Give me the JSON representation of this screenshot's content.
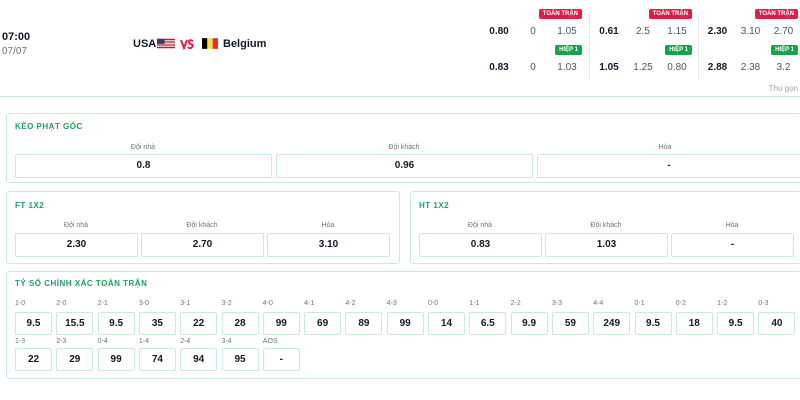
{
  "match": {
    "time": "07:00",
    "date": "07/07",
    "home_team": "USA",
    "away_team": "Belgium"
  },
  "odds": [
    {
      "badge_full": "TOÀN TRẬN",
      "full": [
        "0.80",
        "0",
        "1.05"
      ],
      "badge_half": "HIỆP 1",
      "half": [
        "0.83",
        "0",
        "1.03"
      ]
    },
    {
      "badge_full": "TOÀN TRẬN",
      "full": [
        "0.61",
        "2.5",
        "1.15"
      ],
      "badge_half": "HIỆP 1",
      "half": [
        "1.05",
        "1.25",
        "0.80"
      ]
    },
    {
      "badge_full": "TOÀN TRẬN",
      "full": [
        "2.30",
        "3.10",
        "2.70"
      ],
      "badge_half": "HIỆP 1",
      "half": [
        "2.88",
        "2.38",
        "3.2"
      ]
    }
  ],
  "collapse_label": "Thu gọn",
  "corner": {
    "title": "KÈO PHẠT GÓC",
    "cols": [
      {
        "label": "Đội nhà",
        "value": "0.8"
      },
      {
        "label": "Đội khách",
        "value": "0.96"
      },
      {
        "label": "Hòa",
        "value": "-"
      }
    ]
  },
  "ft": {
    "title": "FT 1X2",
    "cols": [
      {
        "label": "Đội nhà",
        "value": "2.30"
      },
      {
        "label": "Đội khách",
        "value": "2.70"
      },
      {
        "label": "Hòa",
        "value": "3.10"
      }
    ]
  },
  "ht": {
    "title": "HT 1X2",
    "cols": [
      {
        "label": "Đội nhà",
        "value": "0.83"
      },
      {
        "label": "Đội khách",
        "value": "1.03"
      },
      {
        "label": "Hòa",
        "value": "-"
      }
    ]
  },
  "exact": {
    "title": "TỶ SỐ CHÍNH XÁC TOÀN TRẬN",
    "row1": [
      {
        "score": "1-0",
        "odd": "9.5"
      },
      {
        "score": "2-0",
        "odd": "15.5"
      },
      {
        "score": "2-1",
        "odd": "9.5"
      },
      {
        "score": "3-0",
        "odd": "35"
      },
      {
        "score": "3-1",
        "odd": "22"
      },
      {
        "score": "3-2",
        "odd": "28"
      },
      {
        "score": "4-0",
        "odd": "99"
      },
      {
        "score": "4-1",
        "odd": "69"
      },
      {
        "score": "4-2",
        "odd": "89"
      },
      {
        "score": "4-3",
        "odd": "99"
      },
      {
        "score": "0-0",
        "odd": "14"
      },
      {
        "score": "1-1",
        "odd": "6.5"
      },
      {
        "score": "2-2",
        "odd": "9.9"
      },
      {
        "score": "3-3",
        "odd": "59"
      },
      {
        "score": "4-4",
        "odd": "249"
      },
      {
        "score": "0-1",
        "odd": "9.5"
      },
      {
        "score": "0-2",
        "odd": "18"
      },
      {
        "score": "1-2",
        "odd": "9.5"
      },
      {
        "score": "0-3",
        "odd": "40"
      }
    ],
    "row2": [
      {
        "score": "1-3",
        "odd": "22"
      },
      {
        "score": "2-3",
        "odd": "29"
      },
      {
        "score": "0-4",
        "odd": "99"
      },
      {
        "score": "1-4",
        "odd": "74"
      },
      {
        "score": "2-4",
        "odd": "94"
      },
      {
        "score": "3-4",
        "odd": "95"
      },
      {
        "score": "AOS",
        "odd": "-"
      }
    ]
  },
  "colors": {
    "accent": "#1aa260",
    "border": "#c9ecd8",
    "badge_red": "#e11d48",
    "badge_green": "#16a34a"
  }
}
